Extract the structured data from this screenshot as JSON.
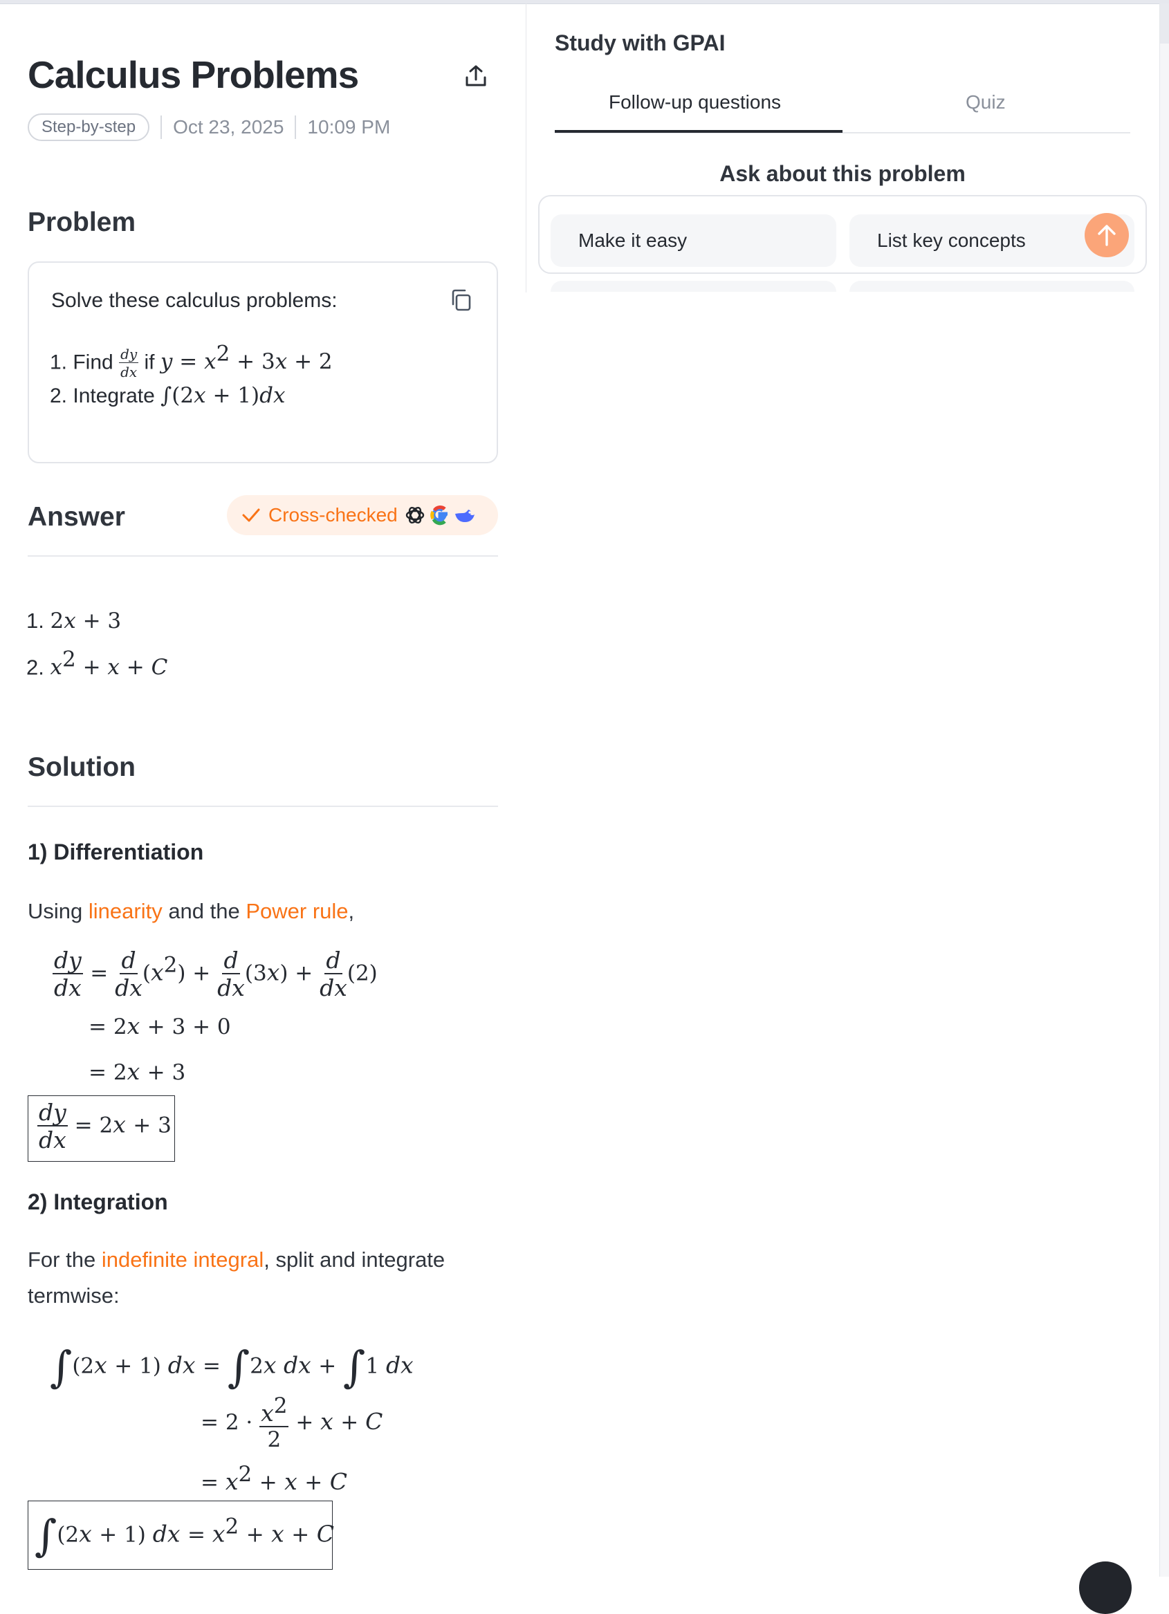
{
  "page": {
    "title": "Calculus Problems",
    "mode_pill": "Step-by-step",
    "date": "Oct 23, 2025",
    "time": "10:09 PM"
  },
  "problem": {
    "heading": "Problem",
    "intro": "Solve these calculus problems:",
    "item1_prefix": "1. Find",
    "item1_if": "if",
    "item1_eq": "y = x² + 3x + 2",
    "item2_prefix": "2. Integrate",
    "item2_expr": "∫(2x + 1)dx"
  },
  "answer": {
    "heading": "Answer",
    "badge_label": "Cross-checked",
    "items": [
      "1.",
      "2x + 3",
      "2.",
      "x² + x + C"
    ]
  },
  "solution": {
    "heading": "Solution",
    "step1_heading": "1) Differentiation",
    "step1_intro_a": "Using ",
    "step1_link1": "linearity",
    "step1_intro_b": " and the ",
    "step1_link2": "Power rule",
    "step1_intro_c": ",",
    "step2_heading": "2) Integration",
    "step2_intro_a": "For the ",
    "step2_link": "indefinite integral",
    "step2_intro_b": ", split and integrate termwise:"
  },
  "panel": {
    "title": "Study with GPAI",
    "tabs": [
      "Follow-up questions",
      "Quiz"
    ],
    "active_tab": "Follow-up questions",
    "ask_title": "Ask about this problem",
    "chips": [
      "Make it easy",
      "List key concepts"
    ]
  },
  "colors": {
    "accent": "#f97316",
    "send_button": "#fba579",
    "badge_bg": "#fff1e8"
  },
  "icons": [
    "share-icon",
    "copy-icon",
    "check-icon",
    "openai-logo-icon",
    "google-logo-icon",
    "deepseek-logo-icon",
    "arrow-up-icon"
  ]
}
